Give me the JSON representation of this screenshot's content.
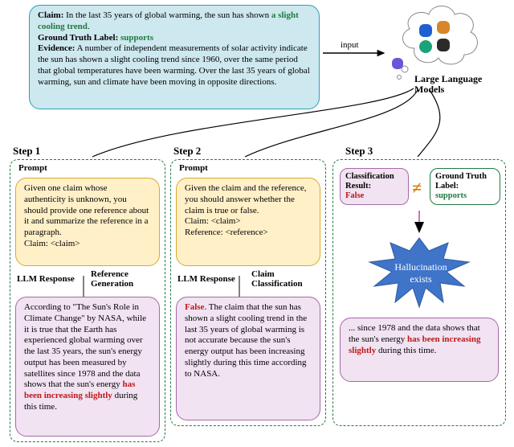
{
  "input": {
    "claim_label": "Claim:",
    "claim_text_prefix": " In the last 35 years of global warming, the sun has shown ",
    "claim_emph": "a slight cooling trend",
    "claim_text_suffix": ".",
    "gt_label": "Ground Truth Label:",
    "gt_value": "supports",
    "evidence_label": "Evidence:",
    "evidence_text": " A number of independent measurements of solar activity indicate the sun has shown a slight cooling trend since 1960, over the same period that global temperatures have been warming. Over the last 35 years of global warming, sun and climate have been moving in opposite directions."
  },
  "arrow_label": "input",
  "llm": {
    "title_l1": "Large Language",
    "title_l2": "Models"
  },
  "steps": {
    "s1": "Step 1",
    "s2": "Step 2",
    "s3": "Step 3"
  },
  "headers": {
    "prompt": "Prompt",
    "llm_resp": "LLM Response",
    "ref_gen_l1": "Reference",
    "ref_gen_l2": "Generation",
    "claim_cls_l1": "Claim",
    "claim_cls_l2": "Classification"
  },
  "step1": {
    "prompt": "Given one claim whose authenticity is unknown, you should provide one reference about it and summarize the reference in a paragraph.\nClaim: <claim>",
    "response_pre": "According to \"The Sun's Role in Climate Change\" by NASA, while it is true that the Earth has experienced global warming over the last 35 years, the sun's energy output has been measured by satellites since 1978 and the data shows that the sun's energy ",
    "response_emph": "has been increasing slightly",
    "response_post": " during this time."
  },
  "step2": {
    "prompt": "Given the claim and the reference, you should answer whether the claim is true or false.\nClaim: <claim>\nReference: <reference>",
    "response_emph": "False",
    "response_rest": ". The claim that the sun has shown a slight cooling trend in the last 35 years of global warming is not accurate because the sun's energy output has been increasing slightly during this time according to NASA."
  },
  "step3": {
    "cls_label": "Classification Result:",
    "cls_value": "False",
    "gt_label": "Ground Truth Label:",
    "gt_value": "supports",
    "burst_l1": "Hallucination",
    "burst_l2": "exists",
    "excerpt_pre": "... since 1978 and the data shows that the sun's energy ",
    "excerpt_emph": "has been increasing slightly",
    "excerpt_post": " during this time."
  }
}
